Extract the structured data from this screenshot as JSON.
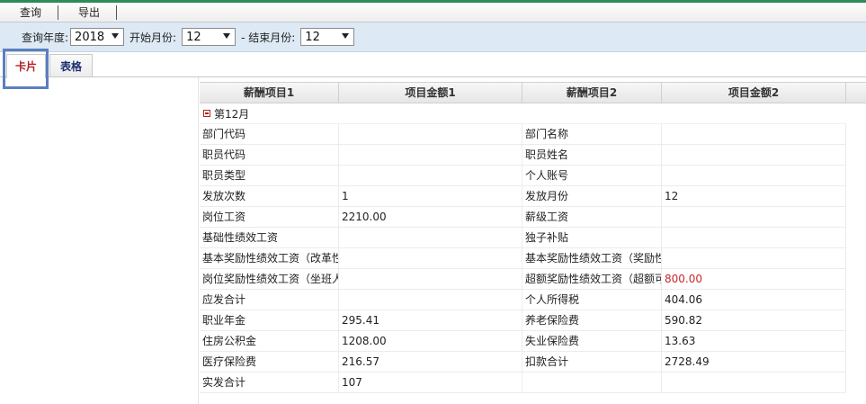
{
  "toolbar": {
    "query_label": "查询",
    "export_label": "导出"
  },
  "filters": {
    "year_label": "查询年度:",
    "year_value": "2018",
    "start_month_label": "开始月份:",
    "start_month_value": "12",
    "end_month_label": "- 结束月份:",
    "end_month_value": "12"
  },
  "tabs": {
    "card_label": "卡片",
    "table_label": "表格"
  },
  "grid": {
    "headers": [
      "薪酬项目1",
      "项目金额1",
      "薪酬项目2",
      "项目金额2"
    ],
    "group_label": "第12月",
    "rows": [
      {
        "item1": "部门代码",
        "amount1": "",
        "item2": "部门名称",
        "amount2": ""
      },
      {
        "item1": "职员代码",
        "amount1": "",
        "item2": "职员姓名",
        "amount2": ""
      },
      {
        "item1": "职员类型",
        "amount1": "",
        "item2": "个人账号",
        "amount2": ""
      },
      {
        "item1": "发放次数",
        "amount1": "1",
        "item2": "发放月份",
        "amount2": "12"
      },
      {
        "item1": "岗位工资",
        "amount1": "2210.00",
        "item2": "薪级工资",
        "amount2": ""
      },
      {
        "item1": "基础性绩效工资",
        "amount1": "",
        "item2": "独子补贴",
        "amount2": ""
      },
      {
        "item1": "基本奖励性绩效工资（改革性",
        "amount1": "",
        "item2": "基本奖励性绩效工资（奖励性",
        "amount2": ""
      },
      {
        "item1": "岗位奖励性绩效工资（坐班人",
        "amount1": "",
        "item2": "超额奖励性绩效工资（超额可",
        "amount2": "800.00"
      },
      {
        "item1": "应发合计",
        "amount1": "",
        "item2": "个人所得税",
        "amount2": "404.06"
      },
      {
        "item1": "职业年金",
        "amount1": "295.41",
        "item2": "养老保险费",
        "amount2": "590.82"
      },
      {
        "item1": "住房公积金",
        "amount1": "1208.00",
        "item2": "失业保险费",
        "amount2": "13.63"
      },
      {
        "item1": "医疗保险费",
        "amount1": "216.57",
        "item2": "扣款合计",
        "amount2": "2728.49"
      },
      {
        "item1": "实发合计",
        "amount1": "107",
        "item2": "",
        "amount2": ""
      }
    ]
  },
  "colors": {
    "highlight_value": "#c62828",
    "active_tab": "#b22222",
    "focus_box": "#5b7fc0"
  }
}
